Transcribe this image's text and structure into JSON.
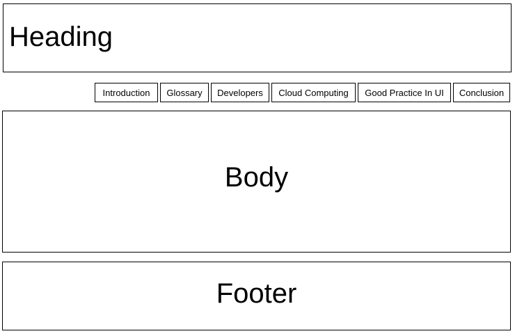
{
  "heading": {
    "label": "Heading"
  },
  "nav": {
    "items": [
      {
        "label": "Introduction"
      },
      {
        "label": "Glossary"
      },
      {
        "label": "Developers"
      },
      {
        "label": "Cloud Computing"
      },
      {
        "label": "Good Practice In UI"
      },
      {
        "label": "Conclusion"
      }
    ]
  },
  "body_section": {
    "label": "Body"
  },
  "footer": {
    "label": "Footer"
  },
  "colors": {
    "border": "#000000",
    "background": "#ffffff",
    "text": "#000000"
  }
}
